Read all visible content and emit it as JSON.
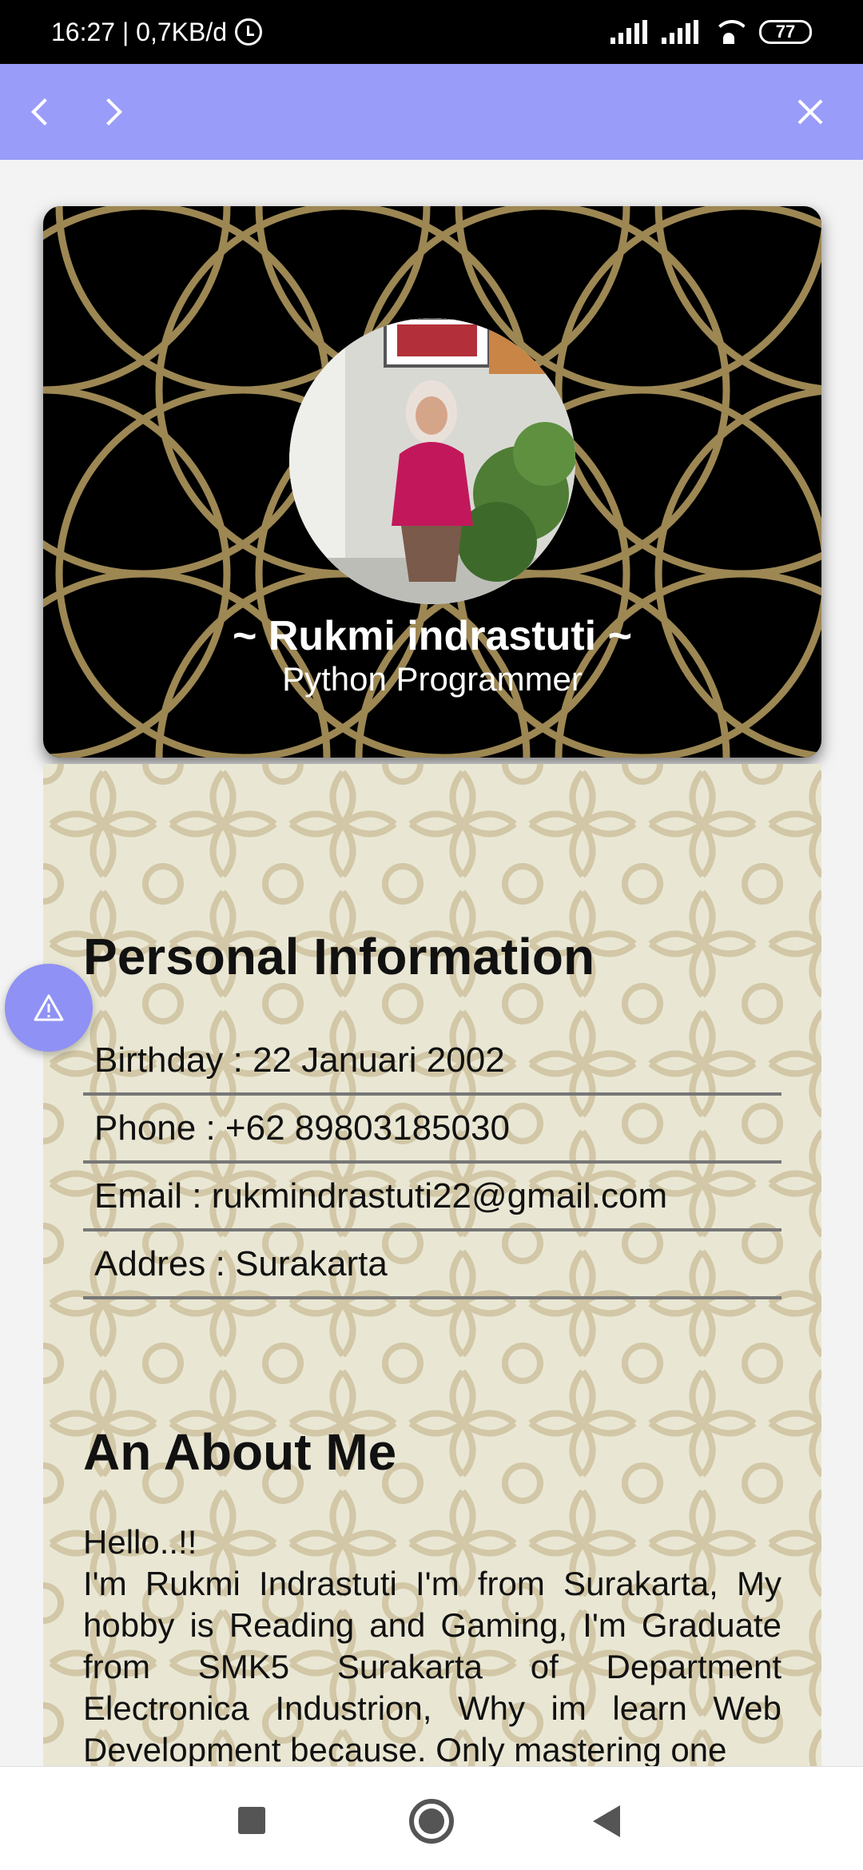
{
  "status_bar": {
    "time_speed": "16:27 | 0,7KB/d",
    "battery": "77",
    "icons": [
      "alarm-icon",
      "signal-icon",
      "signal-icon",
      "wifi-icon",
      "battery-icon"
    ]
  },
  "top_bar": {
    "color": "#9a9cf9",
    "icons": [
      "chevron-left-icon",
      "chevron-right-icon",
      "close-icon"
    ]
  },
  "profile": {
    "name": "~ Rukmi indrastuti ~",
    "role": "Python Programmer"
  },
  "personal_info": {
    "title": "Personal Information",
    "rows": [
      "Birthday : 22 Januari 2002",
      "Phone : +62 89803185030",
      "Email : rukmindrastuti22@gmail.com",
      "Addres : Surakarta"
    ]
  },
  "about": {
    "title": "An About Me",
    "greeting": "Hello..!!",
    "text": "I'm Rukmi Indrastuti I'm from Surakarta, My hobby is Reading and Gaming, I'm Graduate from SMK5 Surakarta of Department Electronica Industrion, Why im learn Web Development because. Only mastering one"
  },
  "fab": {
    "icon": "warning-icon",
    "color": "#8f91f4"
  },
  "nav_bar": {
    "icons": [
      "recents-square-icon",
      "home-circle-icon",
      "back-triangle-icon"
    ]
  }
}
